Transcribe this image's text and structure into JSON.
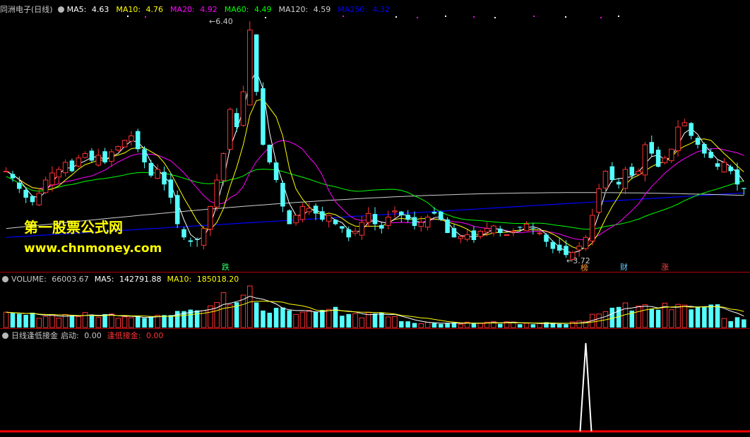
{
  "main_panel": {
    "stock_name": "同洲电子",
    "period": "(日线)",
    "ma": [
      {
        "label": "MA5:",
        "value": "4.63",
        "color": "#ffffff"
      },
      {
        "label": "MA10:",
        "value": "4.76",
        "color": "#ffff00"
      },
      {
        "label": "MA20:",
        "value": "4.92",
        "color": "#ff00ff"
      },
      {
        "label": "MA60:",
        "value": "4.49",
        "color": "#00ff00"
      },
      {
        "label": "MA120:",
        "value": "4.59",
        "color": "#d0d0d0"
      },
      {
        "label": "MA250:",
        "value": "4.32",
        "color": "#0000ff"
      }
    ],
    "high_label": "6.40",
    "low_label": "3.72",
    "markers": [
      {
        "text": "跌",
        "color": "#33ff66"
      },
      {
        "text": "榜",
        "color": "#ff9933"
      },
      {
        "text": "财",
        "color": "#66ccff"
      },
      {
        "text": "涨",
        "color": "#ff4444"
      }
    ],
    "watermark_title": "第一股票公式网",
    "watermark_url": "www.chnmoney.com"
  },
  "volume_panel": {
    "label": "VOLUME:",
    "value": "66003.67",
    "ma5_label": "MA5:",
    "ma5_value": "142791.88",
    "ma10_label": "MA10:",
    "ma10_value": "185018.20"
  },
  "indicator_panel": {
    "name": "日线逢低接金",
    "qidong_label": "启动:",
    "qidong_value": "0.00",
    "fengdi_label": "逢低接金:",
    "fengdi_value": "0.00"
  },
  "colors": {
    "up": "#ff3232",
    "down": "#54ffff",
    "divider": "#b40000",
    "ma5": "#ffffff",
    "ma10": "#ffff00",
    "ma20": "#ff00ff",
    "ma60": "#00ff00",
    "ma120": "#d0d0d0",
    "ma250": "#0000ff"
  },
  "chart_data": {
    "type": "candlestick",
    "y_range": [
      3.72,
      6.4
    ],
    "closes": [
      4.7,
      4.62,
      4.5,
      4.4,
      4.35,
      4.45,
      4.6,
      4.68,
      4.72,
      4.8,
      4.7,
      4.85,
      4.9,
      4.82,
      4.88,
      4.8,
      4.92,
      4.98,
      5.05,
      5.1,
      4.95,
      4.8,
      4.65,
      4.72,
      4.55,
      4.4,
      4.1,
      3.95,
      3.9,
      3.92,
      4.05,
      4.3,
      4.6,
      4.9,
      5.4,
      5.2,
      5.6,
      6.3,
      5.6,
      5.0,
      4.8,
      4.6,
      4.3,
      4.1,
      4.2,
      4.3,
      4.28,
      4.22,
      4.15,
      4.2,
      4.1,
      4.05,
      3.95,
      4.02,
      4.12,
      4.22,
      4.1,
      4.05,
      4.18,
      4.25,
      4.2,
      4.15,
      4.08,
      4.12,
      4.18,
      4.22,
      4.15,
      4.0,
      3.95,
      3.96,
      3.98,
      3.92,
      4.02,
      4.05,
      4.08,
      4.0,
      3.98,
      4.02,
      4.06,
      4.1,
      4.05,
      4.0,
      3.9,
      3.82,
      3.8,
      3.75,
      3.78,
      3.85,
      3.95,
      4.2,
      4.5,
      4.7,
      4.6,
      4.55,
      4.72,
      4.65,
      4.7,
      5.0,
      4.9,
      4.75,
      4.85,
      4.95,
      5.2,
      5.25,
      5.1,
      5.0,
      4.9,
      4.85,
      4.75,
      4.8,
      4.7,
      4.55,
      4.5
    ],
    "volume": {
      "ma5": 142791.88,
      "ma10": 185018.2,
      "last": 66003.67
    },
    "indicator": {
      "qidong": 0.0,
      "fengdi": 0.0
    }
  }
}
